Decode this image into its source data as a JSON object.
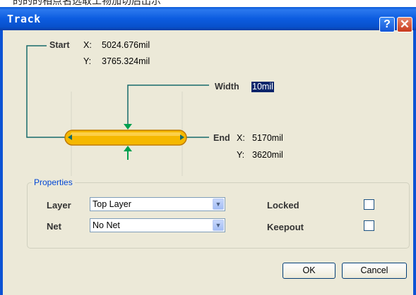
{
  "window": {
    "title": "Track"
  },
  "titlebar_buttons": {
    "help": "?",
    "close": "✕"
  },
  "top_strip": {
    "text": "的的的相点名选取工物加切后出示"
  },
  "start": {
    "label": "Start",
    "x_label": "X:",
    "x_value": "5024.676mil",
    "y_label": "Y:",
    "y_value": "3765.324mil"
  },
  "width": {
    "label": "Width",
    "value": "10mil"
  },
  "end": {
    "label": "End",
    "x_label": "X:",
    "x_value": "5170mil",
    "y_label": "Y:",
    "y_value": "3620mil"
  },
  "properties": {
    "group_label": "Properties",
    "layer_label": "Layer",
    "layer_value": "Top Layer",
    "net_label": "Net",
    "net_value": "No Net",
    "locked_label": "Locked",
    "locked_checked": false,
    "keepout_label": "Keepout",
    "keepout_checked": false
  },
  "buttons": {
    "ok": "OK",
    "cancel": "Cancel"
  },
  "colors": {
    "title_bar": "#0c5ce0",
    "track_fill": "#f5b800",
    "leader_line": "#166a6a",
    "arrow": "#00a050"
  }
}
